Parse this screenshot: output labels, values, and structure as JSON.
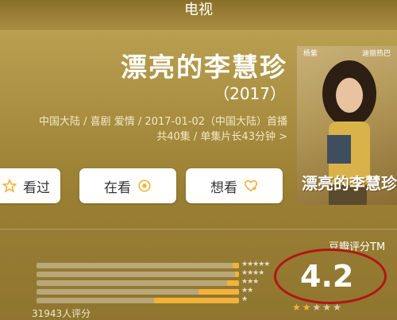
{
  "header": {
    "title": "电视"
  },
  "show": {
    "title": "漂亮的李慧珍",
    "year": "（2017）",
    "meta_line1": "中国大陆 / 喜剧 爱情 / 2017-01-02（中国大陆）首播",
    "meta_line2": "共40集 / 单集片长43分钟 >"
  },
  "actions": [
    {
      "label": "看过",
      "icon": "star-outline-icon"
    },
    {
      "label": "在看",
      "icon": "target-icon"
    },
    {
      "label": "想看",
      "icon": "heart-plus-icon"
    }
  ],
  "poster": {
    "top_left": "杨紫",
    "top_right": "迪丽热巴",
    "caption": "漂亮的李慧珍"
  },
  "rating": {
    "label": "豆瓣评分TM",
    "score": "4.2",
    "count": "31943人评分",
    "distribution": [
      {
        "stars": 5,
        "fraction": 0.03
      },
      {
        "stars": 4,
        "fraction": 0.02
      },
      {
        "stars": 3,
        "fraction": 0.06
      },
      {
        "stars": 2,
        "fraction": 0.2
      },
      {
        "stars": 1,
        "fraction": 0.42
      }
    ],
    "star_colors": {
      "filled": "#f3b23a",
      "empty": "#d9cfae"
    },
    "star_fill": 2.1
  },
  "colors": {
    "accent": "#f3b23a",
    "highlight": "#b31414"
  }
}
